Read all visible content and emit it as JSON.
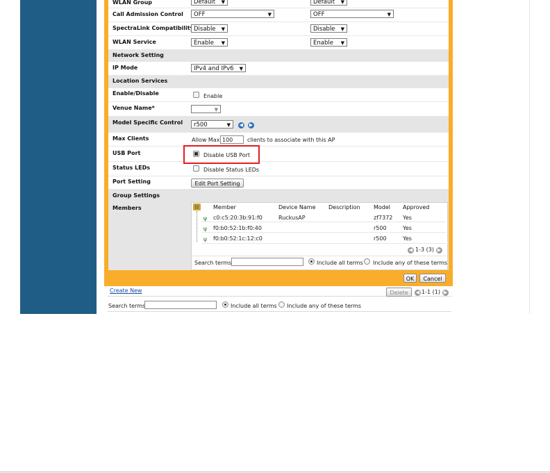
{
  "form": {
    "rows": {
      "wlan_group": {
        "label": "WLAN Group",
        "value_a": "Default",
        "value_b": "Default"
      },
      "call_admission": {
        "label": "Call Admission Control",
        "value_a": "OFF",
        "value_b": "OFF"
      },
      "spectralink": {
        "label": "SpectraLink Compatibility",
        "value_a": "Disable",
        "value_b": "Disable"
      },
      "wlan_service": {
        "label": "WLAN Service",
        "value_a": "Enable",
        "value_b": "Enable"
      }
    },
    "network_setting": {
      "header": "Network Setting",
      "ip_mode_label": "IP Mode",
      "ip_mode_value": "IPv4 and IPv6"
    },
    "location_services": {
      "header": "Location Services",
      "enable_label": "Enable/Disable",
      "enable_text": "Enable",
      "enable_checked": false,
      "venue_label": "Venue Name*",
      "venue_value": ""
    },
    "model_specific": {
      "label": "Model Specific Control",
      "value": "r500"
    },
    "max_clients": {
      "label": "Max Clients",
      "prefix": "Allow Max",
      "value": "100",
      "suffix": "clients to associate with this AP"
    },
    "usb_port": {
      "label": "USB Port",
      "text": "Disable USB Port",
      "checked": true
    },
    "status_leds": {
      "label": "Status LEDs",
      "text": "Disable Status LEDs",
      "checked": false
    },
    "port_setting": {
      "label": "Port Setting",
      "button": "Edit Port Setting"
    },
    "group_settings": {
      "header": "Group Settings"
    },
    "members": {
      "label": "Members",
      "columns": [
        "Member",
        "Device Name",
        "Description",
        "Model",
        "Approved"
      ],
      "rows": [
        {
          "member": "c0:c5:20:3b:91:f0",
          "device_name": "RuckusAP",
          "description": "",
          "model": "zf7372",
          "approved": "Yes"
        },
        {
          "member": "f0:b0:52:1b:f0:40",
          "device_name": "",
          "description": "",
          "model": "r500",
          "approved": "Yes"
        },
        {
          "member": "f0:b0:52:1c:12:c0",
          "device_name": "",
          "description": "",
          "model": "r500",
          "approved": "Yes"
        }
      ],
      "pagination": "1-3 (3)",
      "search_label": "Search terms",
      "search_value": "",
      "include_all": "Include all terms",
      "include_any": "Include any of these terms",
      "include_selected": "all"
    },
    "buttons": {
      "ok": "OK",
      "cancel": "Cancel"
    }
  },
  "footer": {
    "create_new": "Create New",
    "delete": "Delete",
    "pagination": "1-1 (1)",
    "search_label": "Search terms",
    "search_value": "",
    "include_all": "Include all terms",
    "include_any": "Include any of these terms"
  },
  "colors": {
    "sidebar": "#1f5d86",
    "dialog_border": "#f9ad2a",
    "highlight": "#e21d1d",
    "section_bg": "#e5e5e5"
  },
  "icons": [
    "chevron-down-icon",
    "prev-page-icon",
    "next-page-icon",
    "access-point-icon",
    "group-icon"
  ]
}
